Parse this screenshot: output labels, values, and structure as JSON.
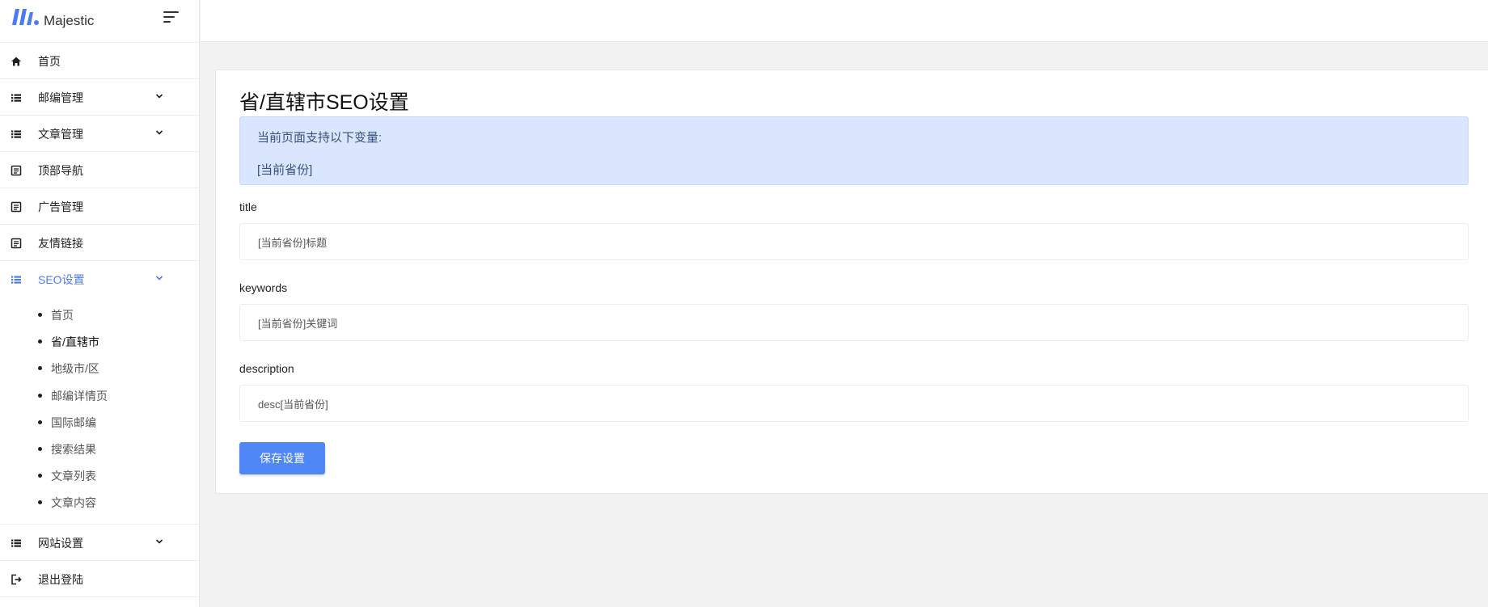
{
  "brand": {
    "name": "Majestic",
    "accent": "#4b7cf3"
  },
  "sidebar": {
    "items": [
      {
        "label": "首页",
        "icon": "home-icon"
      },
      {
        "label": "邮编管理",
        "icon": "list-icon",
        "expandable": true
      },
      {
        "label": "文章管理",
        "icon": "list-icon",
        "expandable": true
      },
      {
        "label": "顶部导航",
        "icon": "document-icon"
      },
      {
        "label": "广告管理",
        "icon": "document-icon"
      },
      {
        "label": "友情链接",
        "icon": "document-icon"
      },
      {
        "label": "SEO设置",
        "icon": "list-icon",
        "expandable": true,
        "active": true
      },
      {
        "label": "网站设置",
        "icon": "list-icon",
        "expandable": true
      },
      {
        "label": "退出登陆",
        "icon": "logout-icon"
      }
    ],
    "seo_submenu": [
      {
        "label": "首页"
      },
      {
        "label": "省/直辖市",
        "current": true
      },
      {
        "label": "地级市/区"
      },
      {
        "label": "邮编详情页"
      },
      {
        "label": "国际邮编"
      },
      {
        "label": "搜索结果"
      },
      {
        "label": "文章列表"
      },
      {
        "label": "文章内容"
      }
    ]
  },
  "main": {
    "title": "省/直辖市SEO设置",
    "alert": {
      "line1": "当前页面支持以下变量:",
      "line2": "[当前省份]"
    },
    "fields": [
      {
        "label": "title",
        "value": "[当前省份]标题"
      },
      {
        "label": "keywords",
        "value": "[当前省份]关键词"
      },
      {
        "label": "description",
        "value": "desc[当前省份]"
      }
    ],
    "save_label": "保存设置"
  }
}
